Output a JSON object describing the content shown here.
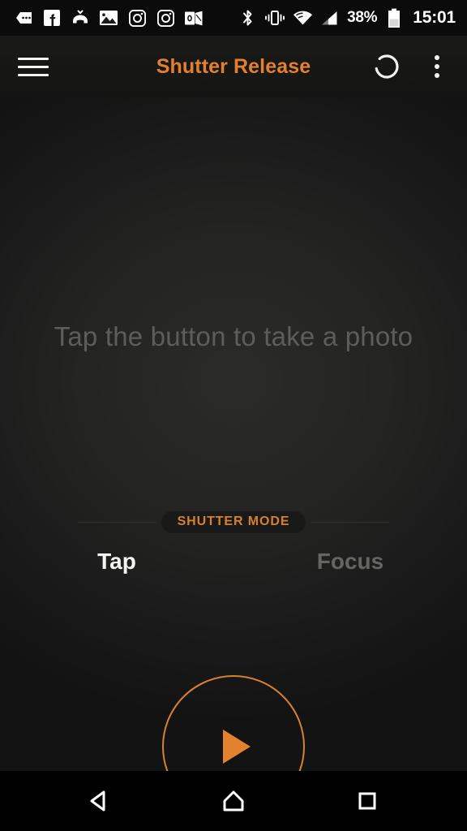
{
  "statusbar": {
    "notification_icons": [
      {
        "name": "sms-message-icon"
      },
      {
        "name": "facebook-icon"
      },
      {
        "name": "missed-call-icon"
      },
      {
        "name": "gallery-photo-icon"
      },
      {
        "name": "instagram-icon"
      },
      {
        "name": "instagram-icon"
      },
      {
        "name": "outlook-icon"
      }
    ],
    "system_icons": [
      {
        "name": "bluetooth-icon"
      },
      {
        "name": "vibrate-icon"
      },
      {
        "name": "wifi-icon"
      },
      {
        "name": "cell-signal-icon"
      }
    ],
    "battery_percent": "38%",
    "clock": "15:01"
  },
  "appbar": {
    "menu_icon": "hamburger-menu-icon",
    "title": "Shutter Release",
    "power_icon": "power-standby-icon",
    "overflow_icon": "overflow-menu-icon",
    "title_color": "#e2802f"
  },
  "main": {
    "hint": "Tap the button to take a photo",
    "section_label": "SHUTTER MODE",
    "modes": [
      {
        "label": "Tap",
        "selected": true
      },
      {
        "label": "Focus",
        "selected": false
      }
    ],
    "shutter_button": {
      "icon": "play-triangle-icon",
      "accent_color": "#e2822f"
    }
  },
  "navbar": {
    "buttons": [
      {
        "name": "back-button",
        "icon": "back-triangle-icon"
      },
      {
        "name": "home-button",
        "icon": "home-icon"
      },
      {
        "name": "recents-button",
        "icon": "recents-square-icon"
      }
    ]
  }
}
